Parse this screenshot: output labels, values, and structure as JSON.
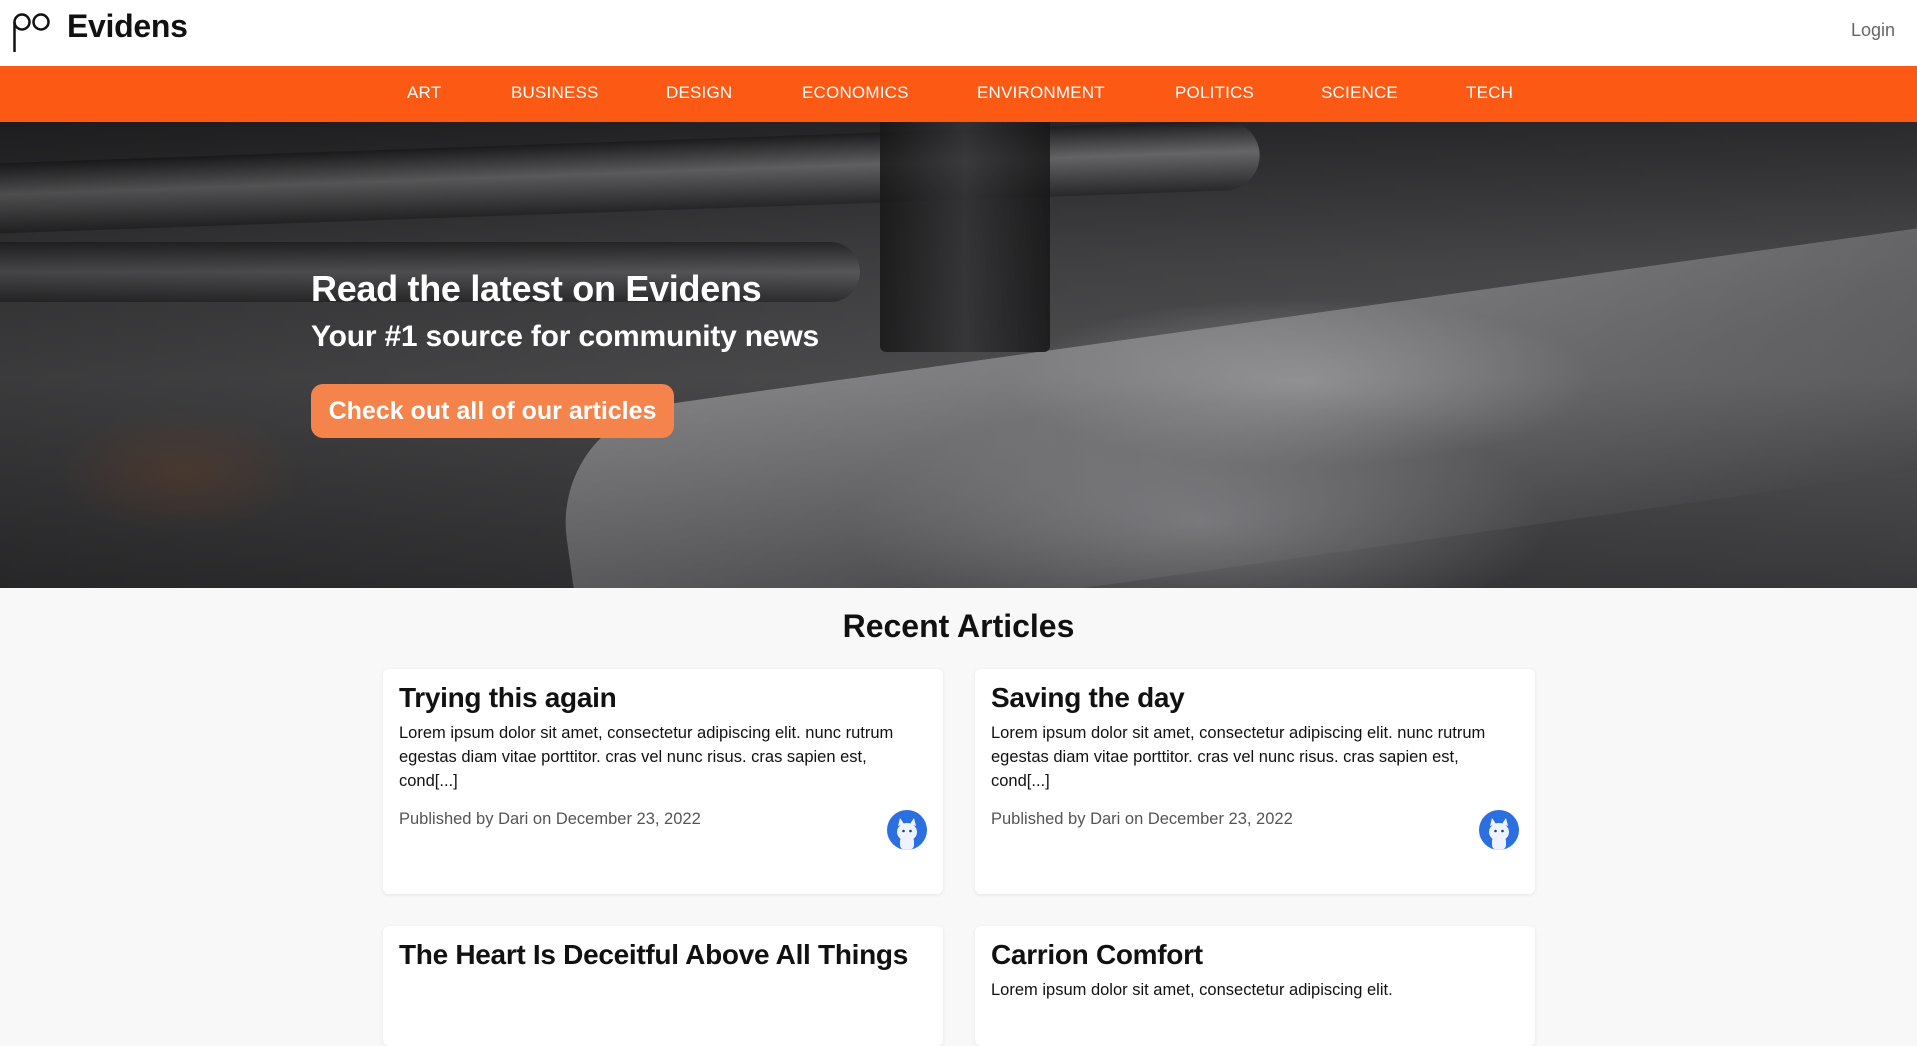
{
  "header": {
    "brand": "Evidens",
    "login_label": "Login"
  },
  "nav": {
    "items": [
      {
        "label": "ART"
      },
      {
        "label": "BUSINESS"
      },
      {
        "label": "DESIGN"
      },
      {
        "label": "ECONOMICS"
      },
      {
        "label": "ENVIRONMENT"
      },
      {
        "label": "POLITICS"
      },
      {
        "label": "SCIENCE"
      },
      {
        "label": "TECH"
      }
    ]
  },
  "hero": {
    "title": "Read the latest on Evidens",
    "subtitle": "Your #1 source for community news",
    "cta_label": "Check out all of our articles"
  },
  "recent": {
    "title": "Recent Articles",
    "articles": [
      {
        "title": "Trying this again",
        "excerpt": "Lorem ipsum dolor sit amet, consectetur adipiscing elit. nunc rutrum egestas diam vitae porttitor. cras vel nunc risus. cras sapien est, cond[...]",
        "meta": "Published by Dari on December 23, 2022"
      },
      {
        "title": "Saving the day",
        "excerpt": "Lorem ipsum dolor sit amet, consectetur adipiscing elit. nunc rutrum egestas diam vitae porttitor. cras vel nunc risus. cras sapien est, cond[...]",
        "meta": "Published by Dari on December 23, 2022"
      },
      {
        "title": "The Heart Is Deceitful Above All Things",
        "excerpt": "",
        "meta": ""
      },
      {
        "title": "Carrion Comfort",
        "excerpt": "Lorem ipsum dolor sit amet, consectetur adipiscing elit.",
        "meta": ""
      }
    ]
  },
  "colors": {
    "nav_bg": "#fc5a14",
    "cta_bg": "#f5834c",
    "avatar_bg": "#2b6fe0"
  },
  "icons": {
    "logo": "evidens-logo-icon",
    "avatar": "cat-avatar-icon"
  }
}
